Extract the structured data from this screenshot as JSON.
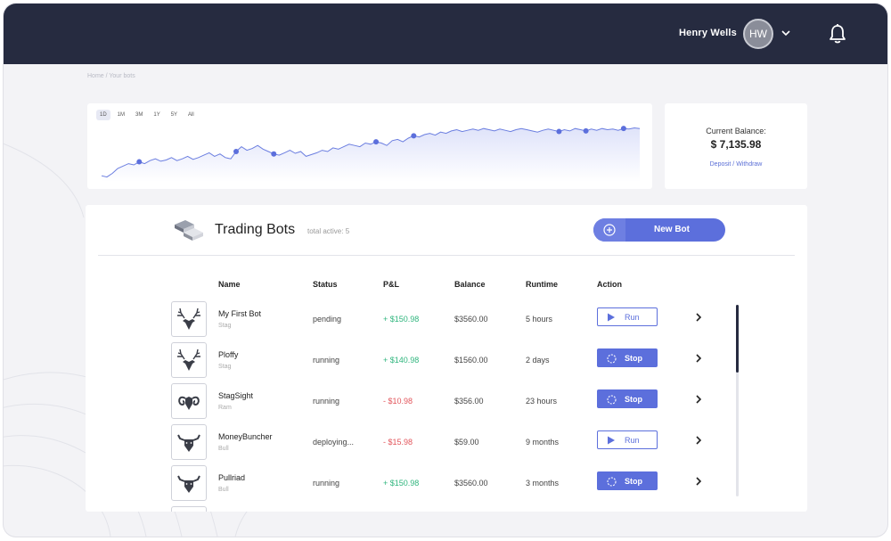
{
  "header": {
    "user_name": "Henry Wells",
    "avatar_initials": "HW",
    "background_color": "#262b40"
  },
  "breadcrumb": "Home / Your bots",
  "chart": {
    "range_tabs": [
      "1D",
      "1M",
      "3M",
      "1Y",
      "5Y",
      "All"
    ],
    "active_tab": "1M",
    "line_color": "#6b7ee0",
    "fill_color": "#dfe3fa"
  },
  "chart_data": {
    "type": "area",
    "title": "",
    "xlabel": "",
    "ylabel": "",
    "x_range": [
      0,
      100
    ],
    "ylim": [
      0,
      100
    ],
    "grid": false,
    "values": [
      10,
      8,
      14,
      22,
      26,
      30,
      28,
      33,
      30,
      35,
      38,
      34,
      36,
      40,
      35,
      38,
      42,
      37,
      40,
      44,
      48,
      42,
      46,
      40,
      38,
      50,
      58,
      52,
      55,
      60,
      54,
      50,
      46,
      44,
      48,
      52,
      47,
      50,
      42,
      45,
      48,
      52,
      50,
      56,
      54,
      58,
      62,
      60,
      58,
      64,
      62,
      66,
      64,
      60,
      68,
      70,
      66,
      72,
      76,
      74,
      78,
      80,
      77,
      82,
      80,
      84,
      86,
      83,
      85,
      87,
      85,
      88,
      86,
      84,
      87,
      85,
      83,
      86,
      88,
      86,
      84,
      82,
      85,
      87,
      85,
      83,
      86,
      84,
      88,
      86,
      84,
      87,
      85,
      88,
      86,
      87,
      85,
      88,
      87,
      89,
      88
    ],
    "markers": [
      7,
      25,
      32,
      51,
      58,
      85,
      90,
      97
    ]
  },
  "balance": {
    "label": "Current Balance:",
    "value": "$ 7,135.98",
    "link": "Deposit / Withdraw"
  },
  "bots": {
    "title": "Trading Bots",
    "subtitle": "total active: 5",
    "new_bot_label": "New Bot",
    "columns": [
      "Name",
      "Status",
      "P&L",
      "Balance",
      "Runtime",
      "Action"
    ],
    "rows": [
      {
        "name": "My First Bot",
        "type": "Stag",
        "status": "pending",
        "pnl": "+ $150.98",
        "pnl_sign": "pos",
        "balance": "$3560.00",
        "runtime": "5 hours",
        "action": "Run",
        "icon": "stag-icon"
      },
      {
        "name": "Ploffy",
        "type": "Stag",
        "status": "running",
        "pnl": "+ $140.98",
        "pnl_sign": "pos",
        "balance": "$1560.00",
        "runtime": "2 days",
        "action": "Stop",
        "icon": "stag-icon"
      },
      {
        "name": "StagSight",
        "type": "Ram",
        "status": "running",
        "pnl": "- $10.98",
        "pnl_sign": "neg",
        "balance": "$356.00",
        "runtime": "23 hours",
        "action": "Stop",
        "icon": "ram-icon"
      },
      {
        "name": "MoneyBuncher",
        "type": "Bull",
        "status": "deploying...",
        "pnl": "- $15.98",
        "pnl_sign": "neg",
        "balance": "$59.00",
        "runtime": "9 months",
        "action": "Run",
        "icon": "bull-icon"
      },
      {
        "name": "Pullriad",
        "type": "Bull",
        "status": "running",
        "pnl": "+ $150.98",
        "pnl_sign": "pos",
        "balance": "$3560.00",
        "runtime": "3 months",
        "action": "Stop",
        "icon": "bull-icon"
      }
    ]
  },
  "colors": {
    "accent": "#5c6fdc",
    "positive": "#2fb57d",
    "negative": "#e2555b"
  }
}
